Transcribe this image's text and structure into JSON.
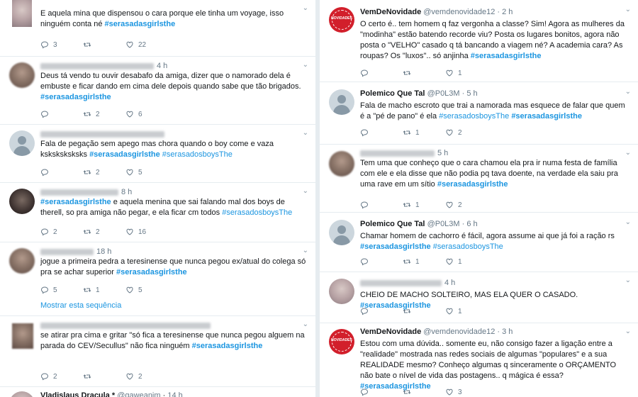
{
  "left": [
    {
      "handle_text": "",
      "time": "",
      "pre": "E aquela mina que dispensou o cara porque ele tinha um voyage, isso ninguém conta né ",
      "tag1": "#serasadasgirlsthe",
      "mid": "",
      "tag2": "",
      "post": "",
      "reply": "3",
      "retweet": "",
      "like": "22"
    },
    {
      "time": "4 h",
      "pre": "Deus tá vendo tu ouvir desabafo da amiga, dizer que o namorado dela é embuste e ficar dando em cima dele depois quando sabe que tão brigados. ",
      "tag1": "#serasadasgirlsthe",
      "mid": "",
      "tag2": "",
      "post": "",
      "reply": "",
      "retweet": "2",
      "like": "6"
    },
    {
      "time": "",
      "pre": "Fala de pegação sem apego mas chora quando o boy come e vaza ksksksksksks ",
      "tag1": "#serasadasgirlsthe",
      "mid": " ",
      "tag2": "#serasadosboysThe",
      "post": "",
      "reply": "",
      "retweet": "2",
      "like": "5"
    },
    {
      "time": "8 h",
      "pre": "",
      "tag1": "#serasadasgirlsthe",
      "mid": " e aquela menina que sai falando mal dos boys de therell, so pra amiga não pegar, e ela ficar cm todos ",
      "tag2": "#serasadosboysThe",
      "post": "",
      "reply": "2",
      "retweet": "2",
      "like": "16"
    },
    {
      "time": "18 h",
      "pre": "jogue a primeira pedra a teresinense que nunca pegou ex/atual do colega só pra se achar superior ",
      "tag1": "#serasadasgirlsthe",
      "mid": "",
      "tag2": "",
      "post": "",
      "reply": "5",
      "retweet": "1",
      "like": "5",
      "more": "Mostrar esta sequência"
    },
    {
      "time": "",
      "pre": "se atirar pra cima e gritar \"só fica a teresinense que nunca pegou alguem na parada do CEV/Secullus\" não fica ninguém ",
      "tag1": "#serasadasgirlsthe",
      "mid": "",
      "tag2": "",
      "post": "",
      "reply": "2",
      "retweet": "",
      "like": "2"
    },
    {
      "name": "Vladislaus Dracula *",
      "handle": "@gaweanim",
      "time": "14 h"
    }
  ],
  "right": [
    {
      "name": "VemDeNovidade",
      "handle": "@vemdenovidade12",
      "time": "2 h",
      "avatar_text": "NOVIDADES",
      "pre": "O certo é.. tem homem q faz vergonha a classe? Sim! Agora as mulheres da \"modinha\" estão batendo recorde viu? Posta os lugares bonitos, agora não posta o \"VELHO\" casado q tá bancando a viagem né? A academia cara? As roupas? Os \"luxos\".. só anjinha ",
      "tag1": "#serasadasgirlsthe",
      "mid": "",
      "tag2": "",
      "post": "",
      "reply": "",
      "retweet": "",
      "like": "1"
    },
    {
      "name": "Polemico Que Tal",
      "handle": "@P0L3M",
      "time": "5 h",
      "pre": "Fala de macho escroto que trai a namorada mas esquece de falar que quem é a \"pé de pano\" é ela ",
      "tag1": "#serasadosboysThe",
      "mid": " ",
      "tag2": "#serasadasgirlsthe",
      "post": "",
      "reply": "",
      "retweet": "1",
      "like": "2"
    },
    {
      "time": "5 h",
      "pre": "Tem uma que conheço que o cara chamou ela pra ir numa festa de família com ele e ela disse que não podia pq tava doente, na verdade ela saiu pra uma rave em um sítio ",
      "tag1": "#serasadasgirlsthe",
      "mid": "",
      "tag2": "",
      "post": "",
      "reply": "",
      "retweet": "1",
      "like": "2"
    },
    {
      "name": "Polemico Que Tal",
      "handle": "@P0L3M",
      "time": "6 h",
      "pre": "Chamar homem de cachorro é fácil, agora assume ai que já foi a ração rs ",
      "tag1": "#serasadasgirlsthe",
      "mid": " ",
      "tag2": "#serasadosboysThe",
      "post": "",
      "reply": "",
      "retweet": "1",
      "like": "1"
    },
    {
      "time": "4 h",
      "pre": "CHEIO DE MACHO SOLTEIRO, MAS ELA QUER O CASADO. ",
      "tag1": "#serasadasgirlsthe",
      "mid": "",
      "tag2": "",
      "post": "",
      "reply": "",
      "retweet": "",
      "like": "1"
    },
    {
      "name": "VemDeNovidade",
      "handle": "@vemdenovidade12",
      "time": "3 h",
      "avatar_text": "NOVIDADES",
      "pre": "Estou com uma dúvida.. somente eu, não consigo fazer a ligação entre a \"realidade\" mostrada nas redes sociais de algumas \"populares\" e a sua REALIDADE mesmo? Conheço algumas q sinceramente o ORÇAMENTO não bate o nível de vida das postagens.. q mágica é essa? ",
      "tag1": "#serasadasgirlsthe",
      "mid": "",
      "tag2": "",
      "post": "",
      "reply": "",
      "retweet": "",
      "like": "3"
    }
  ],
  "colors": {
    "hashtag": "#1b95e0",
    "muted": "#657786",
    "divider": "#e6ecf0"
  },
  "icons": {
    "reply": "reply-icon",
    "retweet": "retweet-icon",
    "like": "heart-icon",
    "menu": "chevron-down-icon"
  }
}
